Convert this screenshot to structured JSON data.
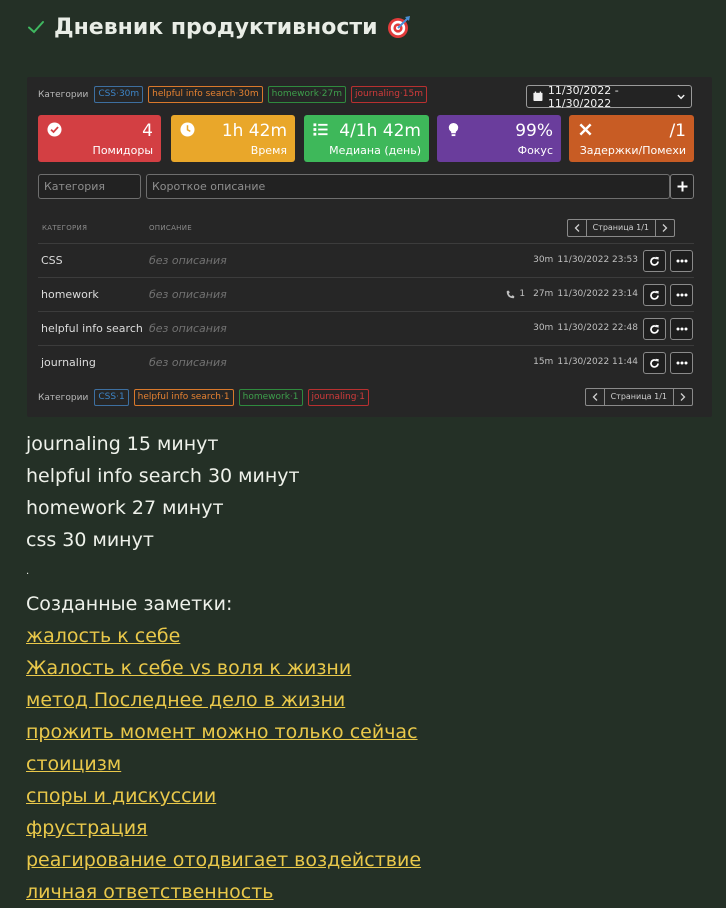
{
  "page": {
    "title": "Дневник продуктивности",
    "title_icon": "check-icon",
    "title_emoji_icon": "target-icon"
  },
  "colors": {
    "background": "#243026",
    "widget": "#262626",
    "link": "#e9c84a",
    "red": "#d33f43",
    "yellow": "#e9a72a",
    "green": "#3eb85a",
    "purple": "#6a3d9c",
    "orange": "#c85c24"
  },
  "widget": {
    "categories_label": "Категории",
    "top_tags": [
      {
        "name": "CSS",
        "sep": "·",
        "value": "30m",
        "color": "blue"
      },
      {
        "name": "helpful info search",
        "sep": "·",
        "value": "30m",
        "color": "orange"
      },
      {
        "name": "homework",
        "sep": "·",
        "value": "27m",
        "color": "green"
      },
      {
        "name": "journaling",
        "sep": "·",
        "value": "15m",
        "color": "red"
      }
    ],
    "date_range": "11/30/2022 - 11/30/2022",
    "stats": [
      {
        "icon": "check-circle-icon",
        "value": "4",
        "label": "Помидоры",
        "color": "red"
      },
      {
        "icon": "clock-icon",
        "value": "1h 42m",
        "label": "Время",
        "color": "yellow"
      },
      {
        "icon": "list-icon",
        "value": "4/1h 42m",
        "label": "Медиана (день)",
        "color": "green"
      },
      {
        "icon": "lightbulb-icon",
        "value": "99%",
        "label": "Фокус",
        "color": "purple"
      },
      {
        "icon": "x-icon",
        "value": "/1",
        "label": "Задержки/Помехи",
        "color": "orange"
      }
    ],
    "category_placeholder": "Категория",
    "description_placeholder": "Короткое описание",
    "table": {
      "col_category": "Категория",
      "col_description": "Описание",
      "pager_text": "Страница 1/1",
      "rows": [
        {
          "category": "CSS",
          "description": "без описания",
          "interruptions": "",
          "duration": "30m",
          "datetime": "11/30/2022 23:53"
        },
        {
          "category": "homework",
          "description": "без описания",
          "interruptions": "1",
          "duration": "27m",
          "datetime": "11/30/2022 23:14"
        },
        {
          "category": "helpful info search",
          "description": "без описания",
          "interruptions": "",
          "duration": "30m",
          "datetime": "11/30/2022 22:48"
        },
        {
          "category": "journaling",
          "description": "без описания",
          "interruptions": "",
          "duration": "15m",
          "datetime": "11/30/2022 11:44"
        }
      ]
    },
    "bottom_tags": [
      {
        "name": "CSS",
        "sep": "·",
        "value": "1",
        "color": "blue"
      },
      {
        "name": "helpful info search",
        "sep": "·",
        "value": "1",
        "color": "orange"
      },
      {
        "name": "homework",
        "sep": "·",
        "value": "1",
        "color": "green"
      },
      {
        "name": "journaling",
        "sep": "·",
        "value": "1",
        "color": "red"
      }
    ]
  },
  "summary": {
    "lines": [
      "journaling 15 минут",
      "helpful info search 30 минут",
      "homework 27 минут",
      "css 30 минут"
    ],
    "dot": ".",
    "notes_heading": "Созданные заметки:",
    "notes": [
      "жалость к себе",
      "Жалость к себе vs воля к жизни",
      "метод Последнее дело в жизни",
      "прожить момент можно только сейчас",
      "стоицизм",
      "споры и дискуссии",
      "фрустрация",
      "реагирование отодвигает воздействие",
      "личная ответственность"
    ]
  }
}
